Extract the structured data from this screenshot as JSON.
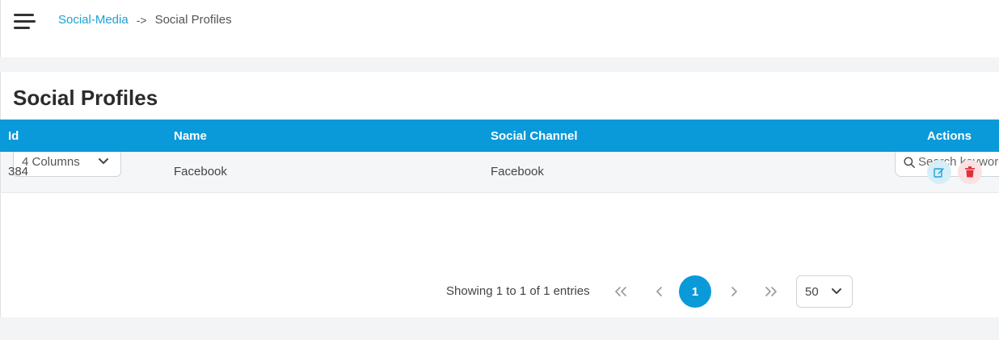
{
  "breadcrumb": {
    "parent": "Social-Media",
    "separator": "->",
    "current": "Social Profiles"
  },
  "page": {
    "title": "Social Profiles"
  },
  "toolbar": {
    "columns_select": "4 Columns",
    "search_placeholder": "Search keywords"
  },
  "table": {
    "headers": {
      "id": "Id",
      "name": "Name",
      "channel": "Social Channel",
      "actions": "Actions"
    },
    "rows": [
      {
        "id": "384",
        "name": "Facebook",
        "channel": "Facebook"
      }
    ]
  },
  "pagination": {
    "summary": "Showing 1 to 1 of 1 entries",
    "current_page": "1",
    "per_page": "50"
  },
  "colors": {
    "accent": "#0a9ad9",
    "link": "#1da1d6",
    "edit_bg": "#d6eefa",
    "delete_bg": "#fbe1e4"
  },
  "icons": {
    "menu": "hamburger-icon",
    "search": "search-icon",
    "edit": "edit-icon",
    "delete": "trash-icon"
  }
}
